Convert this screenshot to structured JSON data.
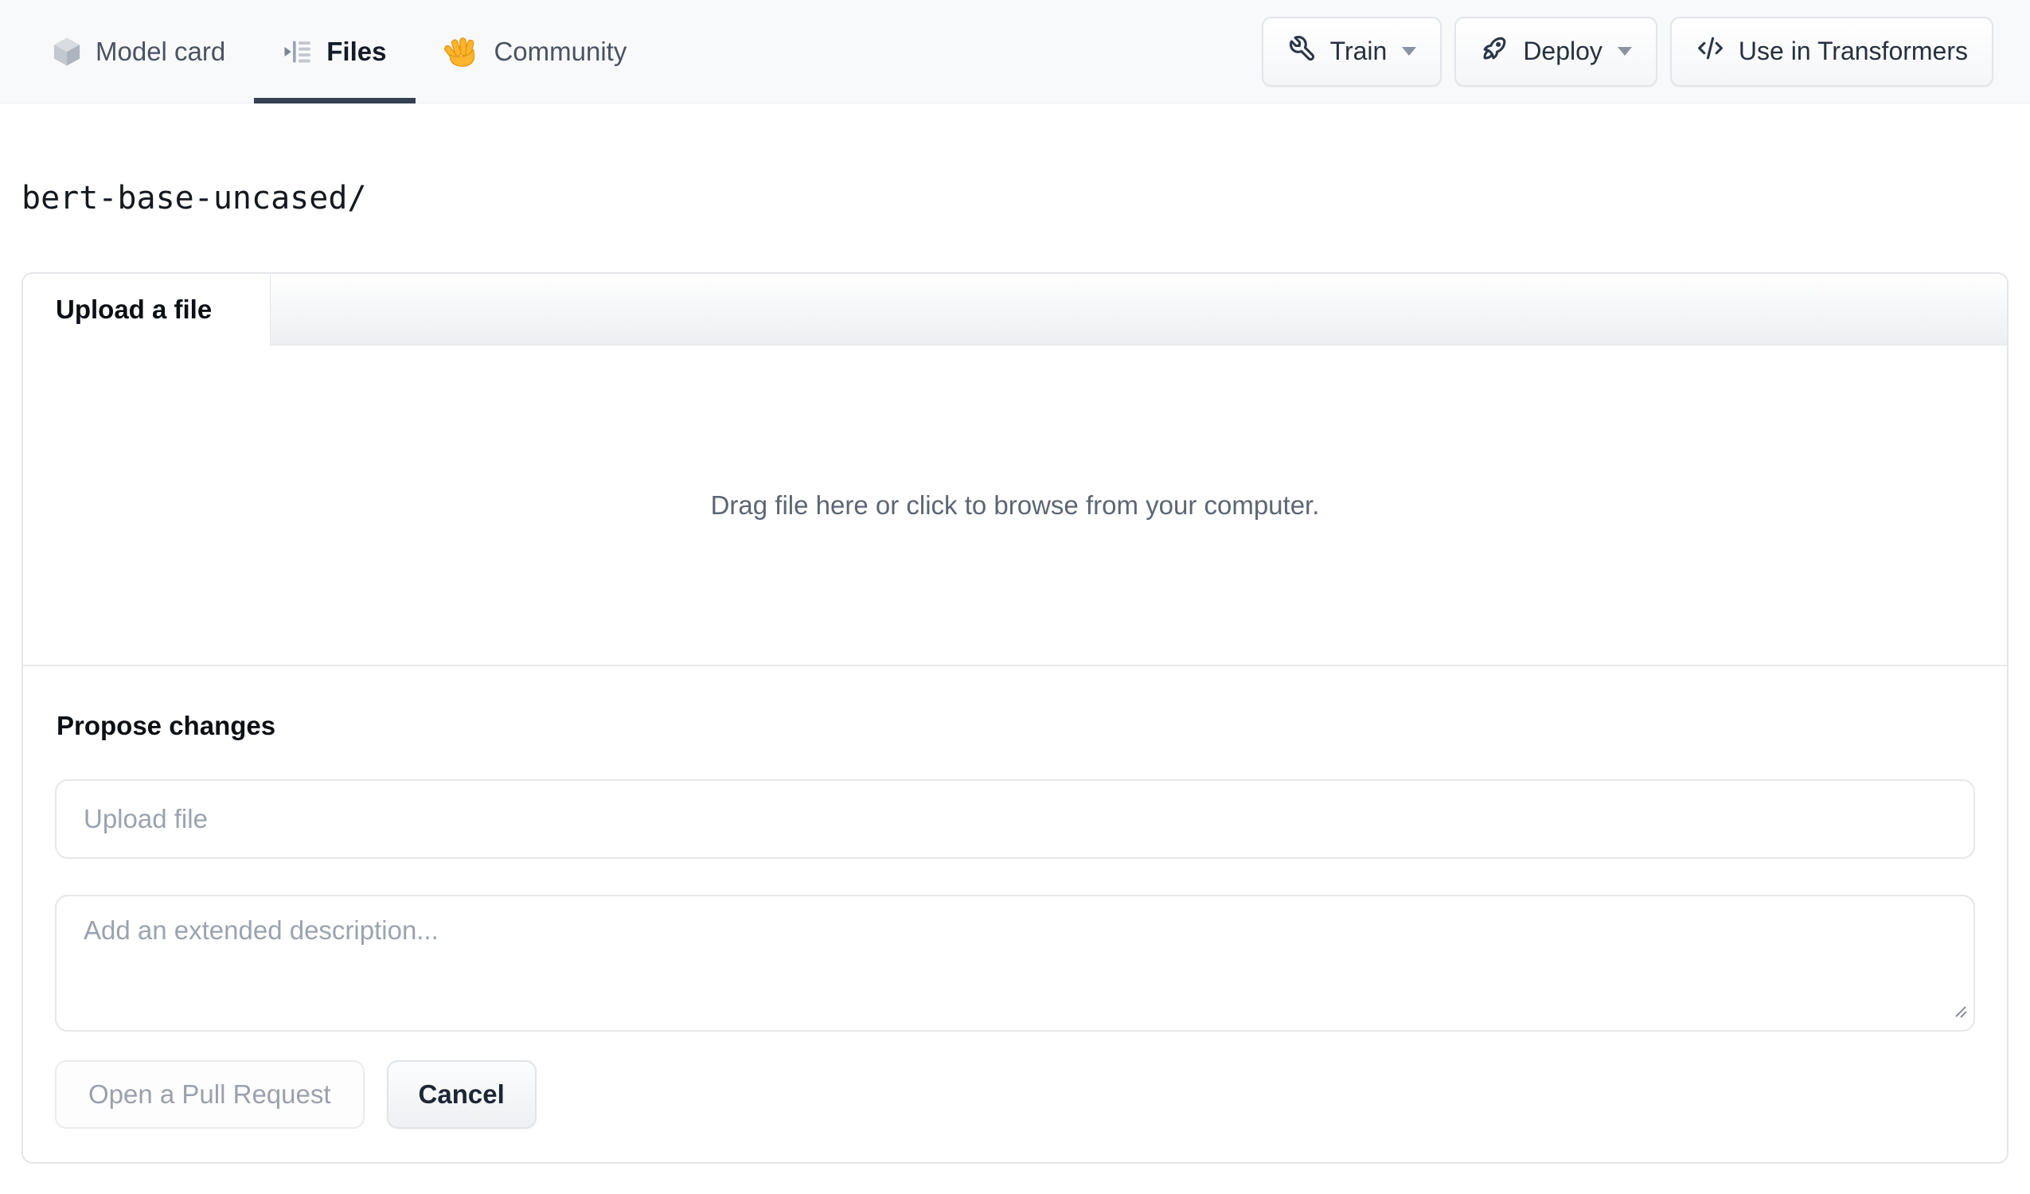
{
  "nav": {
    "tabs": [
      {
        "label": "Model card",
        "icon": "cube-icon",
        "active": false
      },
      {
        "label": "Files",
        "icon": "file-list-icon",
        "active": true
      },
      {
        "label": "Community",
        "icon": "waving-hand-icon",
        "active": false
      }
    ],
    "actions": [
      {
        "label": "Train",
        "icon": "wrench-icon",
        "has_dropdown": true
      },
      {
        "label": "Deploy",
        "icon": "rocket-icon",
        "has_dropdown": true
      },
      {
        "label": "Use in Transformers",
        "icon": "code-icon",
        "has_dropdown": false
      }
    ]
  },
  "breadcrumb": {
    "path": "bert-base-uncased/"
  },
  "upload_panel": {
    "tab_label": "Upload a file",
    "dropzone_text": "Drag file here or click to browse from your computer.",
    "propose_heading": "Propose changes",
    "file_input_placeholder": "Upload file",
    "description_placeholder": "Add an extended description...",
    "open_pr_label": "Open a Pull Request",
    "cancel_label": "Cancel"
  },
  "colors": {
    "active_tab_underline": "#354052",
    "navbar_background": "#f8f9fb",
    "community_hand_orange": "#FDB52E",
    "placeholder_gray": "#9aa3af",
    "panel_border": "#e3e6ea"
  }
}
